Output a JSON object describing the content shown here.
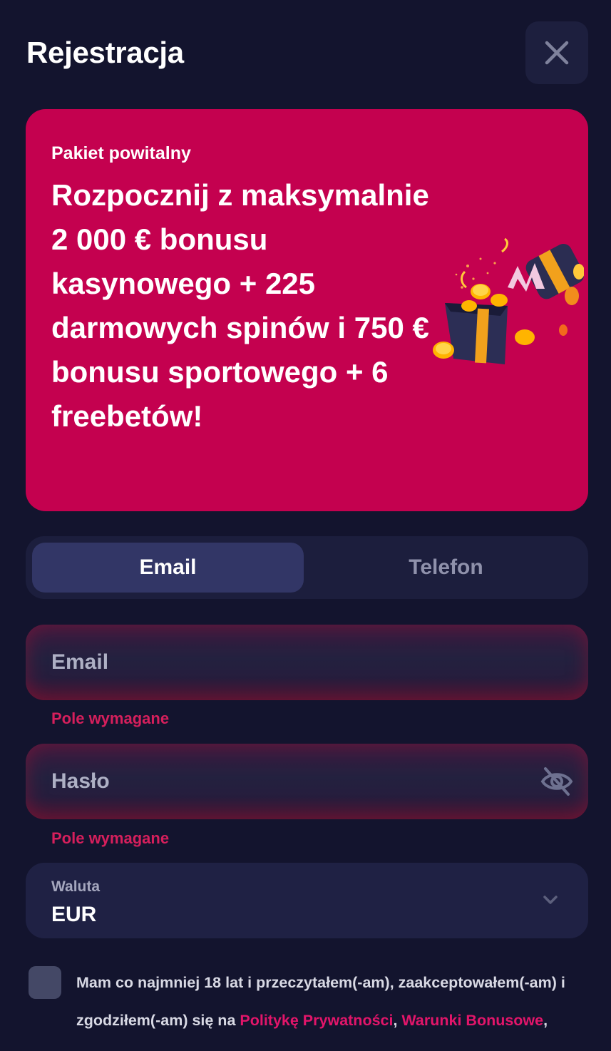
{
  "header": {
    "title": "Rejestracja",
    "close_icon": "close-icon"
  },
  "promo": {
    "kicker": "Pakiet powitalny",
    "headline": "Rozpocznij z maksymalnie 2 000 € bonusu kasynowego + 225 darmowych spinów i 750 € bonusu sportowego + 6 freebetów!",
    "image_icon": "gift-box-with-coins-icon",
    "background_color": "#c4014f"
  },
  "tabs": [
    {
      "label": "Email",
      "active": true
    },
    {
      "label": "Telefon",
      "active": false
    }
  ],
  "form": {
    "email": {
      "placeholder": "Email",
      "value": "",
      "error": "Pole wymagane"
    },
    "password": {
      "placeholder": "Hasło",
      "value": "",
      "error": "Pole wymagane",
      "toggle_icon": "eye-off-icon"
    },
    "currency": {
      "label": "Waluta",
      "value": "EUR",
      "icon": "chevron-down-icon"
    }
  },
  "consent": {
    "checked": false,
    "text_before": "Mam co najmniej 18 lat i przeczytałem(-am), zaakceptowałem(-am) i zgodziłem(-am) się na ",
    "privacy_link": "Politykę Prywatności",
    "separator": ", ",
    "bonus_link": "Warunki Bonusowe",
    "trailing": ","
  },
  "colors": {
    "background": "#13142e",
    "accent": "#c4014f",
    "error": "#d61f5c",
    "link": "#e2156a"
  }
}
